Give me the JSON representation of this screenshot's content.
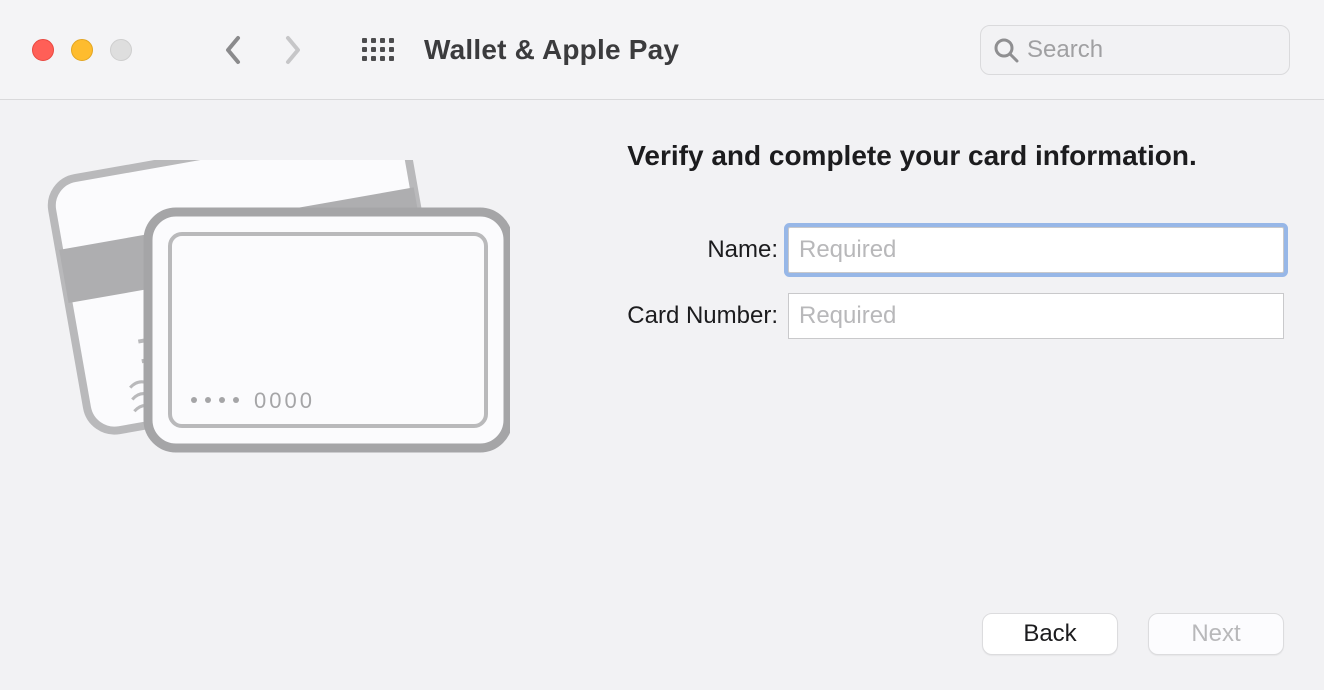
{
  "toolbar": {
    "title": "Wallet & Apple Pay",
    "search_placeholder": "Search"
  },
  "main": {
    "heading": "Verify and complete your card information.",
    "fields": {
      "name": {
        "label": "Name:",
        "placeholder": "Required",
        "value": ""
      },
      "card_number": {
        "label": "Card Number:",
        "placeholder": "Required",
        "value": ""
      }
    },
    "illustration": {
      "last4": "0000"
    }
  },
  "footer": {
    "back": "Back",
    "next": "Next",
    "next_enabled": false
  }
}
